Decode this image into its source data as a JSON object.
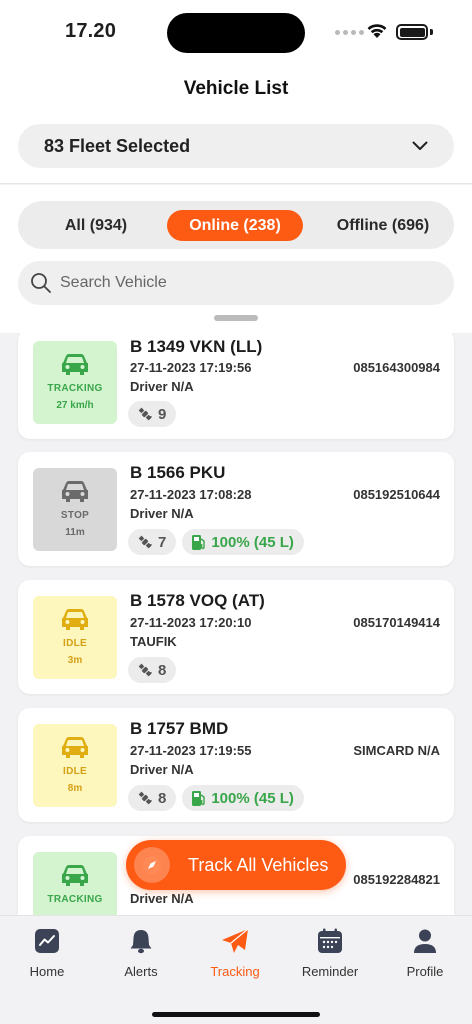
{
  "status_bar": {
    "time": "17.20"
  },
  "header": {
    "title": "Vehicle List",
    "fleet_label": "83 Fleet Selected"
  },
  "filters": {
    "all": "All (934)",
    "online": "Online (238)",
    "offline": "Offline (696)",
    "search_placeholder": "Search Vehicle"
  },
  "vehicles": [
    {
      "status": "TRACKING",
      "sub": "27 km/h",
      "plate": "B 1349 VKN (LL)",
      "datetime": "27-11-2023 17:19:56",
      "phone": "085164300984",
      "driver": "Driver N/A",
      "satellites": "9",
      "fuel": ""
    },
    {
      "status": "STOP",
      "sub": "11m",
      "plate": "B 1566 PKU",
      "datetime": "27-11-2023 17:08:28",
      "phone": "085192510644",
      "driver": "Driver N/A",
      "satellites": "7",
      "fuel": "100% (45 L)"
    },
    {
      "status": "IDLE",
      "sub": "3m",
      "plate": "B 1578 VOQ (AT)",
      "datetime": "27-11-2023 17:20:10",
      "phone": "085170149414",
      "driver": "TAUFIK",
      "satellites": "8",
      "fuel": ""
    },
    {
      "status": "IDLE",
      "sub": "8m",
      "plate": "B 1757 BMD",
      "datetime": "27-11-2023 17:19:55",
      "phone": "SIMCARD N/A",
      "driver": "Driver N/A",
      "satellites": "8",
      "fuel": "100% (45 L)"
    },
    {
      "status": "TRACKING",
      "sub": "",
      "plate": "",
      "datetime": "",
      "phone": "085192284821",
      "driver": "Driver N/A",
      "satellites": "",
      "fuel": ""
    }
  ],
  "track_all_label": "Track All Vehicles",
  "tabs": [
    {
      "label": "Home",
      "icon": "chart-icon"
    },
    {
      "label": "Alerts",
      "icon": "bell-icon"
    },
    {
      "label": "Tracking",
      "icon": "paper-plane-icon"
    },
    {
      "label": "Reminder",
      "icon": "calendar-icon"
    },
    {
      "label": "Profile",
      "icon": "person-icon"
    }
  ],
  "colors": {
    "accent": "#fd5a14",
    "tracking": "#3aa64a",
    "stop": "#6a6a6a",
    "idle": "#d4a016"
  }
}
